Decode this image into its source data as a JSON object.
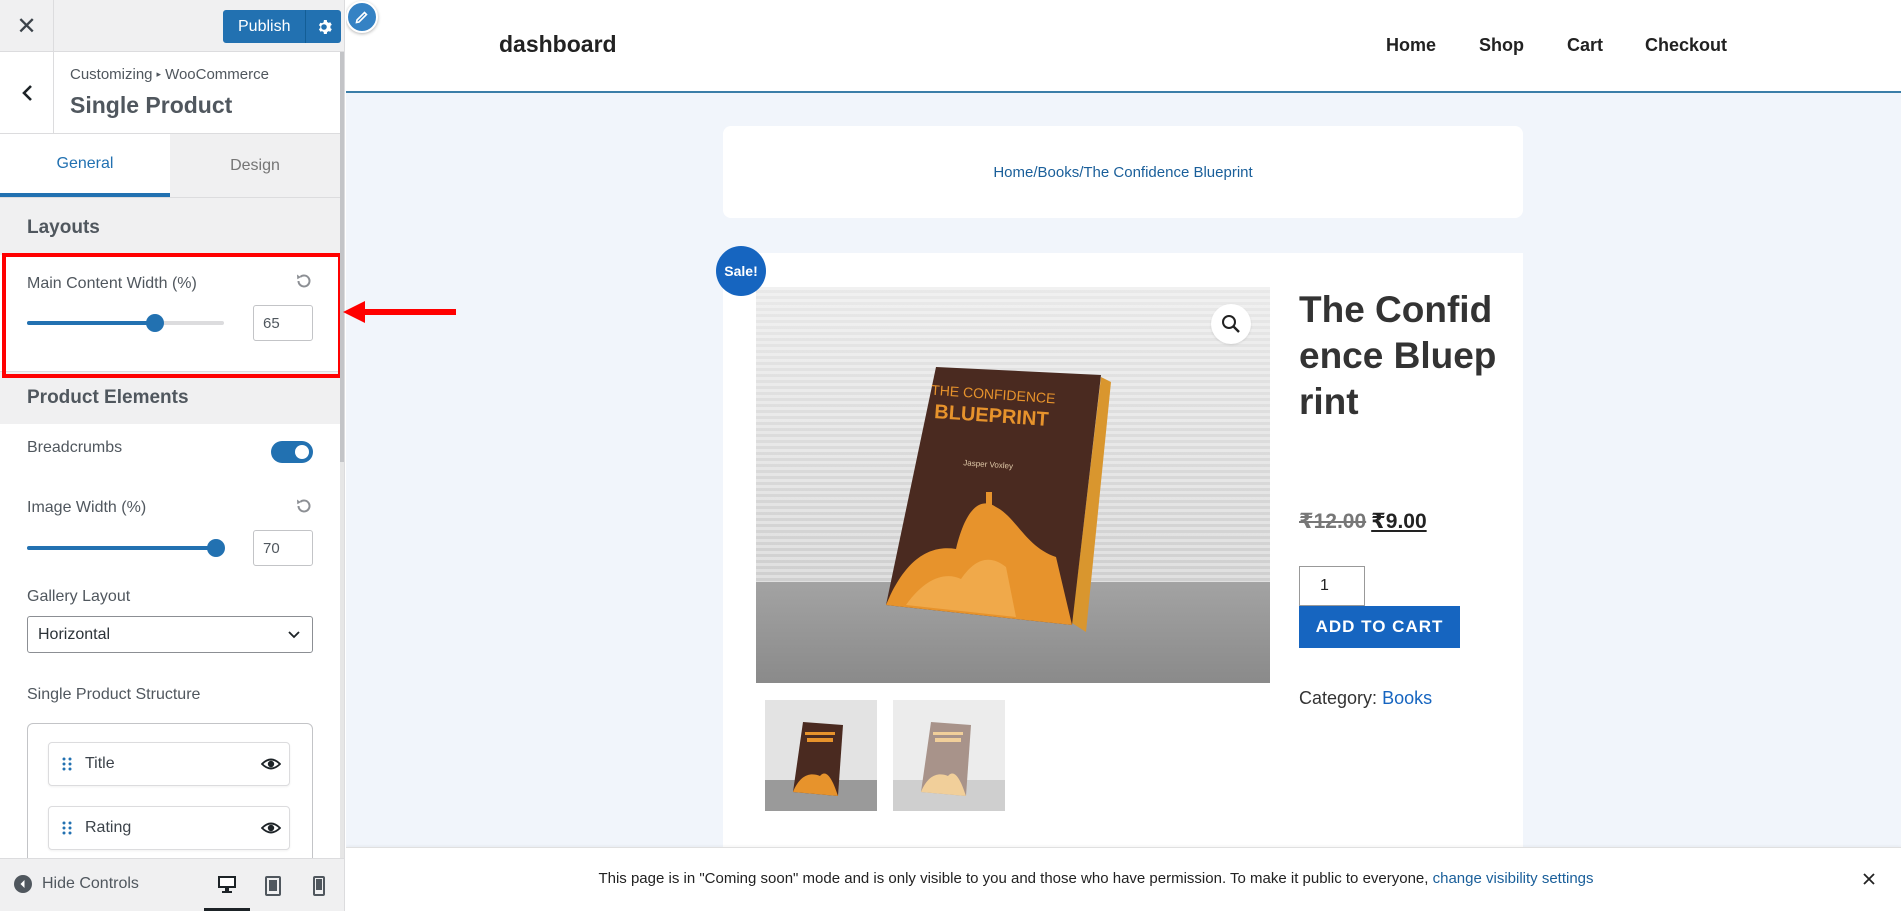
{
  "customizer": {
    "close_label": "✕",
    "publish_label": "Publish",
    "breadcrumb": {
      "root": "Customizing",
      "separator": "▸",
      "parent": "WooCommerce"
    },
    "section_title": "Single Product",
    "tabs": [
      {
        "label": "General",
        "active": true
      },
      {
        "label": "Design",
        "active": false
      }
    ],
    "layouts": {
      "heading": "Layouts",
      "main_content_width": {
        "label": "Main Content Width (%)",
        "value": "65",
        "fraction": 0.65
      }
    },
    "product_elements": {
      "heading": "Product Elements",
      "breadcrumbs": {
        "label": "Breadcrumbs",
        "enabled": true
      },
      "image_width": {
        "label": "Image Width (%)",
        "value": "70",
        "fraction": 0.96
      },
      "gallery_layout": {
        "label": "Gallery Layout",
        "selected": "Horizontal"
      },
      "structure": {
        "label": "Single Product Structure",
        "items": [
          {
            "label": "Title",
            "visible": true
          },
          {
            "label": "Rating",
            "visible": true
          }
        ]
      }
    },
    "footer": {
      "hide_controls": "Hide Controls",
      "active_device": "desktop"
    }
  },
  "site": {
    "title": "dashboard",
    "nav": [
      "Home",
      "Shop",
      "Cart",
      "Checkout"
    ],
    "breadcrumb": {
      "home": "Home",
      "sep1": " / ",
      "category": "Books",
      "sep2": " / ",
      "current": "The Confidence Blueprint"
    },
    "product": {
      "sale_badge": "Sale!",
      "title": "The Confidence Blueprint",
      "old_price": "₹12.00",
      "new_price": "₹9.00",
      "quantity": "1",
      "add_to_cart": "ADD TO CART",
      "category_label": "Category:",
      "category": "Books",
      "book_cover": {
        "line1": "THE CONFIDENCE",
        "line2": "BLUEPRINT",
        "author": "Jasper Voxley"
      }
    },
    "notice": {
      "text": "This page is in \"Coming soon\" mode and is only visible to you and those who have permission. To make it public to everyone, ",
      "link": "change visibility settings"
    }
  },
  "colors": {
    "accent": "#2271b1",
    "site_blue": "#1665c0",
    "highlight": "#ff0000",
    "preview_bg": "#f1f5fb"
  }
}
